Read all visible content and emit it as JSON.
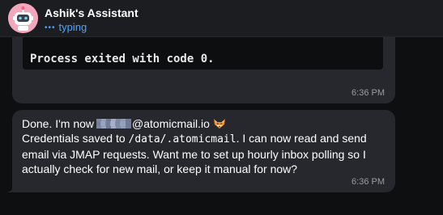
{
  "header": {
    "title": "Ashik's Assistant",
    "status": "typing",
    "avatar": "robot-avatar"
  },
  "messages": [
    {
      "code": "Process exited with code 0.",
      "time": "6:36 PM"
    },
    {
      "line1_prefix": "Done. I'm now",
      "line1_email_domain": "@atomicmail.io",
      "line1_emoji": "fox-face-emoji",
      "line2_prefix": "Credentials saved to",
      "line2_code": "/data/.atomicmail",
      "line2_suffix": ". I can now read and send",
      "line3": "email via JMAP requests. Want me to set up hourly inbox polling so I",
      "line4": "actually check for new mail, or keep it manual for now?",
      "time": "6:36 PM"
    }
  ],
  "colors": {
    "background": "#0e0f11",
    "header": "#1c1d21",
    "bubble": "#26282d",
    "code_block": "#0d0e10",
    "accent": "#4fa3ff",
    "timestamp": "#9a9ca2"
  }
}
